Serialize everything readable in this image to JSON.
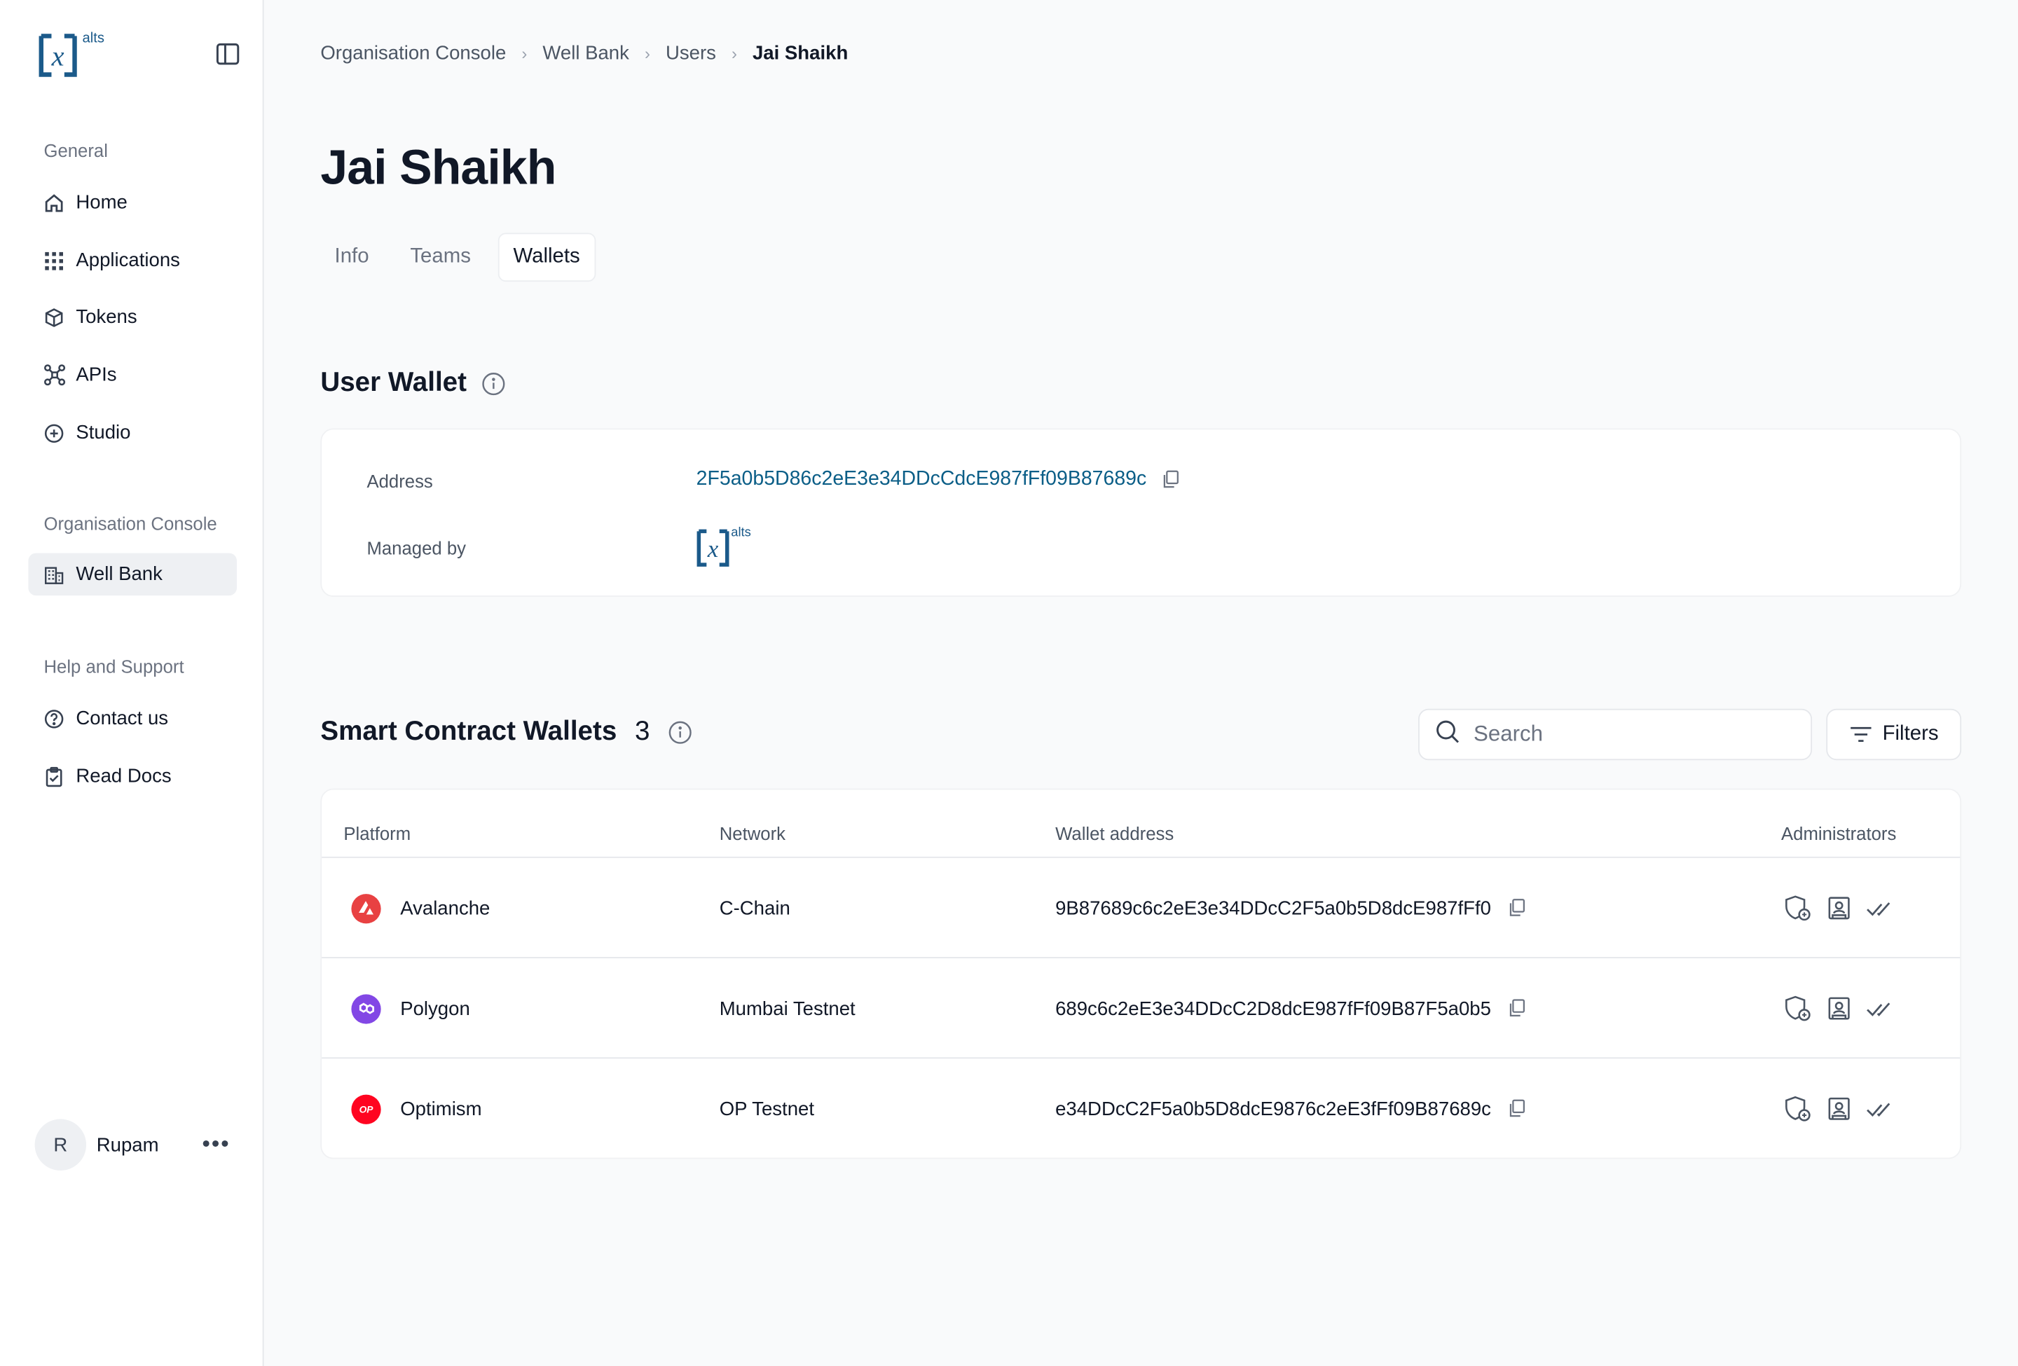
{
  "brand": {
    "logo_text": "x",
    "logo_sup": "alts"
  },
  "sidebar": {
    "general_label": "General",
    "general_items": [
      {
        "label": "Home",
        "icon": "home-icon"
      },
      {
        "label": "Applications",
        "icon": "grid-icon"
      },
      {
        "label": "Tokens",
        "icon": "cube-icon"
      },
      {
        "label": "APIs",
        "icon": "network-icon"
      },
      {
        "label": "Studio",
        "icon": "plus-circle-icon"
      }
    ],
    "org_label": "Organisation Console",
    "org_items": [
      {
        "label": "Well Bank",
        "icon": "building-icon"
      }
    ],
    "help_label": "Help and Support",
    "help_items": [
      {
        "label": "Contact us",
        "icon": "help-circle-icon"
      },
      {
        "label": "Read Docs",
        "icon": "clipboard-check-icon"
      }
    ],
    "user": {
      "initial": "R",
      "name": "Rupam",
      "more": "•••"
    }
  },
  "breadcrumb": [
    "Organisation Console",
    "Well Bank",
    "Users",
    "Jai Shaikh"
  ],
  "page_title": "Jai Shaikh",
  "tabs": [
    {
      "label": "Info",
      "active": false
    },
    {
      "label": "Teams",
      "active": false
    },
    {
      "label": "Wallets",
      "active": true
    }
  ],
  "user_wallet": {
    "heading": "User Wallet",
    "address_label": "Address",
    "address": "2F5a0b5D86c2eE3e34DDcCdcE987fFf09B87689c",
    "managed_label": "Managed by"
  },
  "smart_wallets": {
    "heading": "Smart Contract Wallets",
    "count": "3",
    "search_placeholder": "Search",
    "filters_label": "Filters",
    "columns": [
      "Platform",
      "Network",
      "Wallet address",
      "Administrators"
    ],
    "rows": [
      {
        "platform": "Avalanche",
        "platform_icon": "avalanche-icon",
        "color": "#e84142",
        "network": "C-Chain",
        "address": "9B87689c6c2eE3e34DDcC2F5a0b5D8dcE987fFf0"
      },
      {
        "platform": "Polygon",
        "platform_icon": "polygon-icon",
        "color": "#8247e5",
        "network": "Mumbai Testnet",
        "address": "689c6c2eE3e34DDcC2D8dcE987fFf09B87F5a0b5"
      },
      {
        "platform": "Optimism",
        "platform_icon": "optimism-icon",
        "color": "#ff0420",
        "network": "OP Testnet",
        "address": "e34DDcC2F5a0b5D8dcE9876c2eE3fFf09B87689c",
        "op_text": "OP"
      }
    ]
  },
  "colors": {
    "link": "#0b5e87",
    "brand": "#1b5a8a"
  }
}
